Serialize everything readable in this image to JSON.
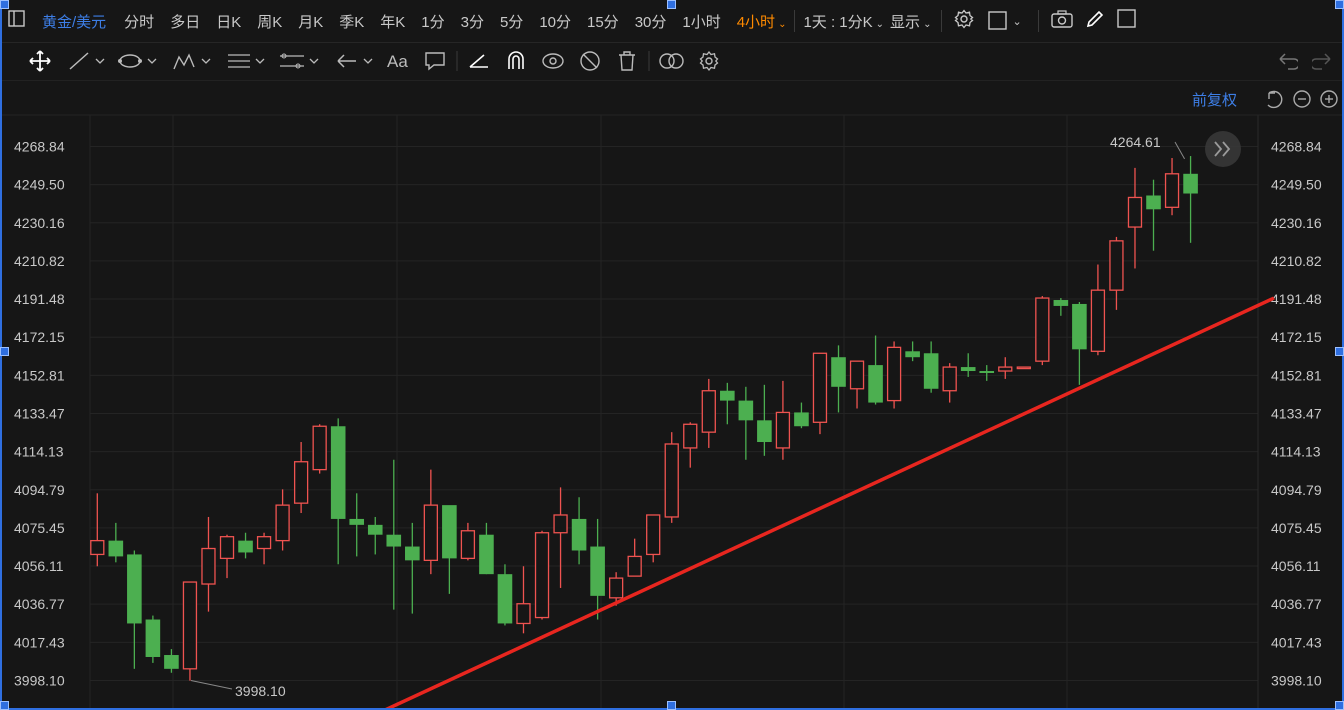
{
  "symbol": "黄金/美元",
  "timeframes": [
    "分时",
    "多日",
    "日K",
    "周K",
    "月K",
    "季K",
    "年K",
    "1分",
    "3分",
    "5分",
    "10分",
    "15分",
    "30分",
    "1小时"
  ],
  "active_timeframe": "4小时",
  "range_selector": "1天 : 1分K",
  "display_label": "显示",
  "adjust_label": "前复权",
  "price_labels": [
    "4268.84",
    "4249.50",
    "4230.16",
    "4210.82",
    "4191.48",
    "4172.15",
    "4152.81",
    "4133.47",
    "4114.13",
    "4094.79",
    "4075.45",
    "4056.11",
    "4036.77",
    "4017.43",
    "3998.10"
  ],
  "high_marker": "4264.61",
  "low_marker": "3998.10",
  "colors": {
    "up": "#ef5350",
    "down": "#4caf50",
    "accent": "#ff8a00",
    "link": "#3d7ee6",
    "trendline": "#e8261f",
    "background": "#161616"
  },
  "chart_data": {
    "type": "candlestick",
    "ylim": [
      3998.1,
      4268.84
    ],
    "candles": [
      {
        "o": 4062,
        "h": 4093,
        "l": 4056,
        "c": 4069
      },
      {
        "o": 4069,
        "h": 4078,
        "l": 4058,
        "c": 4061
      },
      {
        "o": 4062,
        "h": 4064,
        "l": 4004,
        "c": 4027
      },
      {
        "o": 4029,
        "h": 4031,
        "l": 4007,
        "c": 4010
      },
      {
        "o": 4011,
        "h": 4014,
        "l": 4002,
        "c": 4004
      },
      {
        "o": 4004,
        "h": 4043,
        "l": 3998,
        "c": 4048
      },
      {
        "o": 4047,
        "h": 4081,
        "l": 4033,
        "c": 4065
      },
      {
        "o": 4060,
        "h": 4072,
        "l": 4050,
        "c": 4071
      },
      {
        "o": 4069,
        "h": 4073,
        "l": 4060,
        "c": 4063
      },
      {
        "o": 4065,
        "h": 4073,
        "l": 4057,
        "c": 4071
      },
      {
        "o": 4069,
        "h": 4095,
        "l": 4064,
        "c": 4087
      },
      {
        "o": 4088,
        "h": 4119,
        "l": 4083,
        "c": 4109
      },
      {
        "o": 4105,
        "h": 4128,
        "l": 4103,
        "c": 4127
      },
      {
        "o": 4127,
        "h": 4131,
        "l": 4057,
        "c": 4080
      },
      {
        "o": 4080,
        "h": 4093,
        "l": 4061,
        "c": 4077
      },
      {
        "o": 4077,
        "h": 4081,
        "l": 4062,
        "c": 4072
      },
      {
        "o": 4072,
        "h": 4110,
        "l": 4034,
        "c": 4066
      },
      {
        "o": 4066,
        "h": 4078,
        "l": 4032,
        "c": 4059
      },
      {
        "o": 4059,
        "h": 4105,
        "l": 4052,
        "c": 4087
      },
      {
        "o": 4087,
        "h": 4085,
        "l": 4042,
        "c": 4060
      },
      {
        "o": 4060,
        "h": 4078,
        "l": 4059,
        "c": 4074
      },
      {
        "o": 4072,
        "h": 4078,
        "l": 4052,
        "c": 4052
      },
      {
        "o": 4052,
        "h": 4057,
        "l": 4026,
        "c": 4027
      },
      {
        "o": 4027,
        "h": 4056,
        "l": 4022,
        "c": 4037
      },
      {
        "o": 4030,
        "h": 4074,
        "l": 4029,
        "c": 4073
      },
      {
        "o": 4073,
        "h": 4096,
        "l": 4045,
        "c": 4082
      },
      {
        "o": 4080,
        "h": 4091,
        "l": 4057,
        "c": 4064
      },
      {
        "o": 4066,
        "h": 4080,
        "l": 4029,
        "c": 4041
      },
      {
        "o": 4040,
        "h": 4053,
        "l": 4036,
        "c": 4050
      },
      {
        "o": 4051,
        "h": 4070,
        "l": 4051,
        "c": 4061
      },
      {
        "o": 4062,
        "h": 4082,
        "l": 4058,
        "c": 4082
      },
      {
        "o": 4081,
        "h": 4124,
        "l": 4078,
        "c": 4118
      },
      {
        "o": 4116,
        "h": 4129,
        "l": 4106,
        "c": 4128
      },
      {
        "o": 4124,
        "h": 4151,
        "l": 4116,
        "c": 4145
      },
      {
        "o": 4145,
        "h": 4149,
        "l": 4128,
        "c": 4140
      },
      {
        "o": 4140,
        "h": 4147,
        "l": 4110,
        "c": 4130
      },
      {
        "o": 4130,
        "h": 4148,
        "l": 4112,
        "c": 4119
      },
      {
        "o": 4116,
        "h": 4150,
        "l": 4110,
        "c": 4134
      },
      {
        "o": 4134,
        "h": 4139,
        "l": 4126,
        "c": 4127
      },
      {
        "o": 4129,
        "h": 4162,
        "l": 4123,
        "c": 4164
      },
      {
        "o": 4162,
        "h": 4168,
        "l": 4134,
        "c": 4147
      },
      {
        "o": 4146,
        "h": 4158,
        "l": 4136,
        "c": 4160
      },
      {
        "o": 4158,
        "h": 4173,
        "l": 4138,
        "c": 4139
      },
      {
        "o": 4140,
        "h": 4170,
        "l": 4136,
        "c": 4167
      },
      {
        "o": 4165,
        "h": 4170,
        "l": 4160,
        "c": 4162
      },
      {
        "o": 4164,
        "h": 4170,
        "l": 4144,
        "c": 4146
      },
      {
        "o": 4145,
        "h": 4159,
        "l": 4139,
        "c": 4157
      },
      {
        "o": 4157,
        "h": 4164,
        "l": 4152,
        "c": 4155
      },
      {
        "o": 4155,
        "h": 4158,
        "l": 4150,
        "c": 4154
      },
      {
        "o": 4155,
        "h": 4162,
        "l": 4151,
        "c": 4157
      },
      {
        "o": 4157,
        "h": 4157,
        "l": 4157,
        "c": 4157
      },
      {
        "o": 4160,
        "h": 4193,
        "l": 4158,
        "c": 4192
      },
      {
        "o": 4191,
        "h": 4192,
        "l": 4183,
        "c": 4188
      },
      {
        "o": 4189,
        "h": 4190,
        "l": 4148,
        "c": 4166
      },
      {
        "o": 4165,
        "h": 4209,
        "l": 4163,
        "c": 4196
      },
      {
        "o": 4196,
        "h": 4223,
        "l": 4186,
        "c": 4221
      },
      {
        "o": 4228,
        "h": 4258,
        "l": 4207,
        "c": 4243
      },
      {
        "o": 4244,
        "h": 4252,
        "l": 4216,
        "c": 4237
      },
      {
        "o": 4238,
        "h": 4263,
        "l": 4234,
        "c": 4255
      },
      {
        "o": 4255,
        "h": 4264,
        "l": 4220,
        "c": 4245
      }
    ],
    "trendline": {
      "from": {
        "candle": 15.5,
        "price": 3983
      },
      "to": {
        "candle": 63.5,
        "price": 4192
      }
    }
  }
}
